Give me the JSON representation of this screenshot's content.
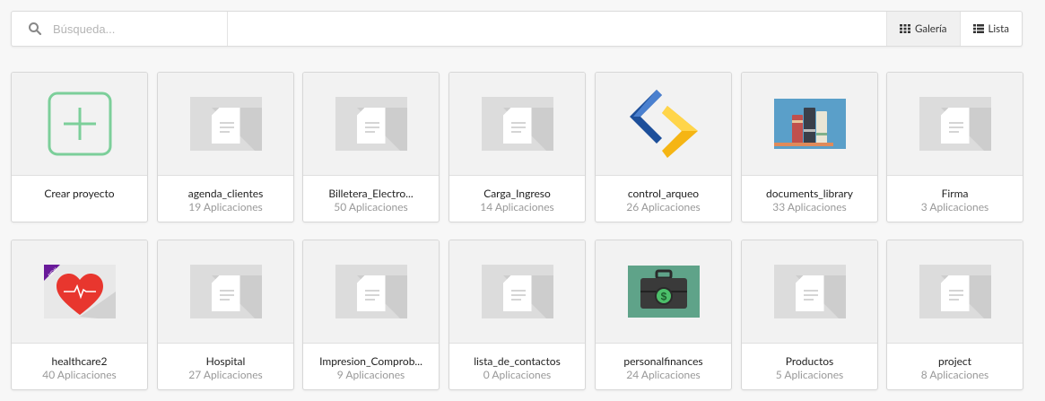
{
  "search": {
    "placeholder": "Búsqueda..."
  },
  "view_toggle": {
    "gallery_label": "Galería",
    "list_label": "Lista"
  },
  "create_card": {
    "label": "Crear proyecto"
  },
  "projects": [
    {
      "name": "agenda_clientes",
      "count": "19 Aplicaciones",
      "icon": "document-icon"
    },
    {
      "name": "Billetera_Electro...",
      "count": "50 Aplicaciones",
      "icon": "document-icon"
    },
    {
      "name": "Carga_Ingreso",
      "count": "14 Aplicaciones",
      "icon": "document-icon"
    },
    {
      "name": "control_arqueo",
      "count": "26 Aplicaciones",
      "icon": "arrows-logo-icon"
    },
    {
      "name": "documents_library",
      "count": "33 Aplicaciones",
      "icon": "books-icon"
    },
    {
      "name": "Firma",
      "count": "3 Aplicaciones",
      "icon": "document-icon"
    },
    {
      "name": "healthcare2",
      "count": "40 Aplicaciones",
      "icon": "heart-icon",
      "badge": "NEW"
    },
    {
      "name": "Hospital",
      "count": "27 Aplicaciones",
      "icon": "document-icon"
    },
    {
      "name": "Impresion_Comprob...",
      "count": "9 Aplicaciones",
      "icon": "document-icon"
    },
    {
      "name": "lista_de_contactos",
      "count": "0 Aplicaciones",
      "icon": "document-icon"
    },
    {
      "name": "personalfinances",
      "count": "24 Aplicaciones",
      "icon": "money-briefcase-icon"
    },
    {
      "name": "Productos",
      "count": "5 Aplicaciones",
      "icon": "document-icon"
    },
    {
      "name": "project",
      "count": "8 Aplicaciones",
      "icon": "document-icon"
    }
  ],
  "colors": {
    "accent_green": "#7ccf9a",
    "border": "#d7d7d7",
    "muted_text": "#999999"
  }
}
